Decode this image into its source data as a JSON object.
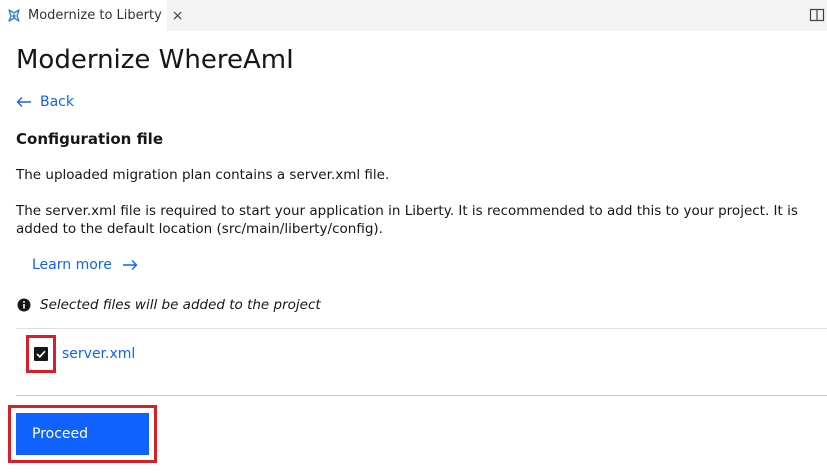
{
  "tab": {
    "label": "Modernize to Liberty",
    "icon": "liberty-app-icon",
    "close_glyph": "×"
  },
  "toolbar": {
    "split_icon": "split-editor-icon"
  },
  "page": {
    "title": "Modernize WhereAmI",
    "back_label": "Back",
    "section_title": "Configuration file",
    "paragraph1": "The uploaded migration plan contains a server.xml file.",
    "paragraph2": "The server.xml file is required to start your application in Liberty. It is recommended to add this to your project. It is added to the default location (src/main/liberty/config).",
    "learn_more_label": "Learn more",
    "info_text": "Selected files will be added to the project",
    "files": [
      {
        "name": "server.xml",
        "checked": true
      }
    ],
    "proceed_label": "Proceed"
  },
  "colors": {
    "accent": "#0f62fe",
    "highlight": "#da1e28",
    "text": "#161616"
  }
}
